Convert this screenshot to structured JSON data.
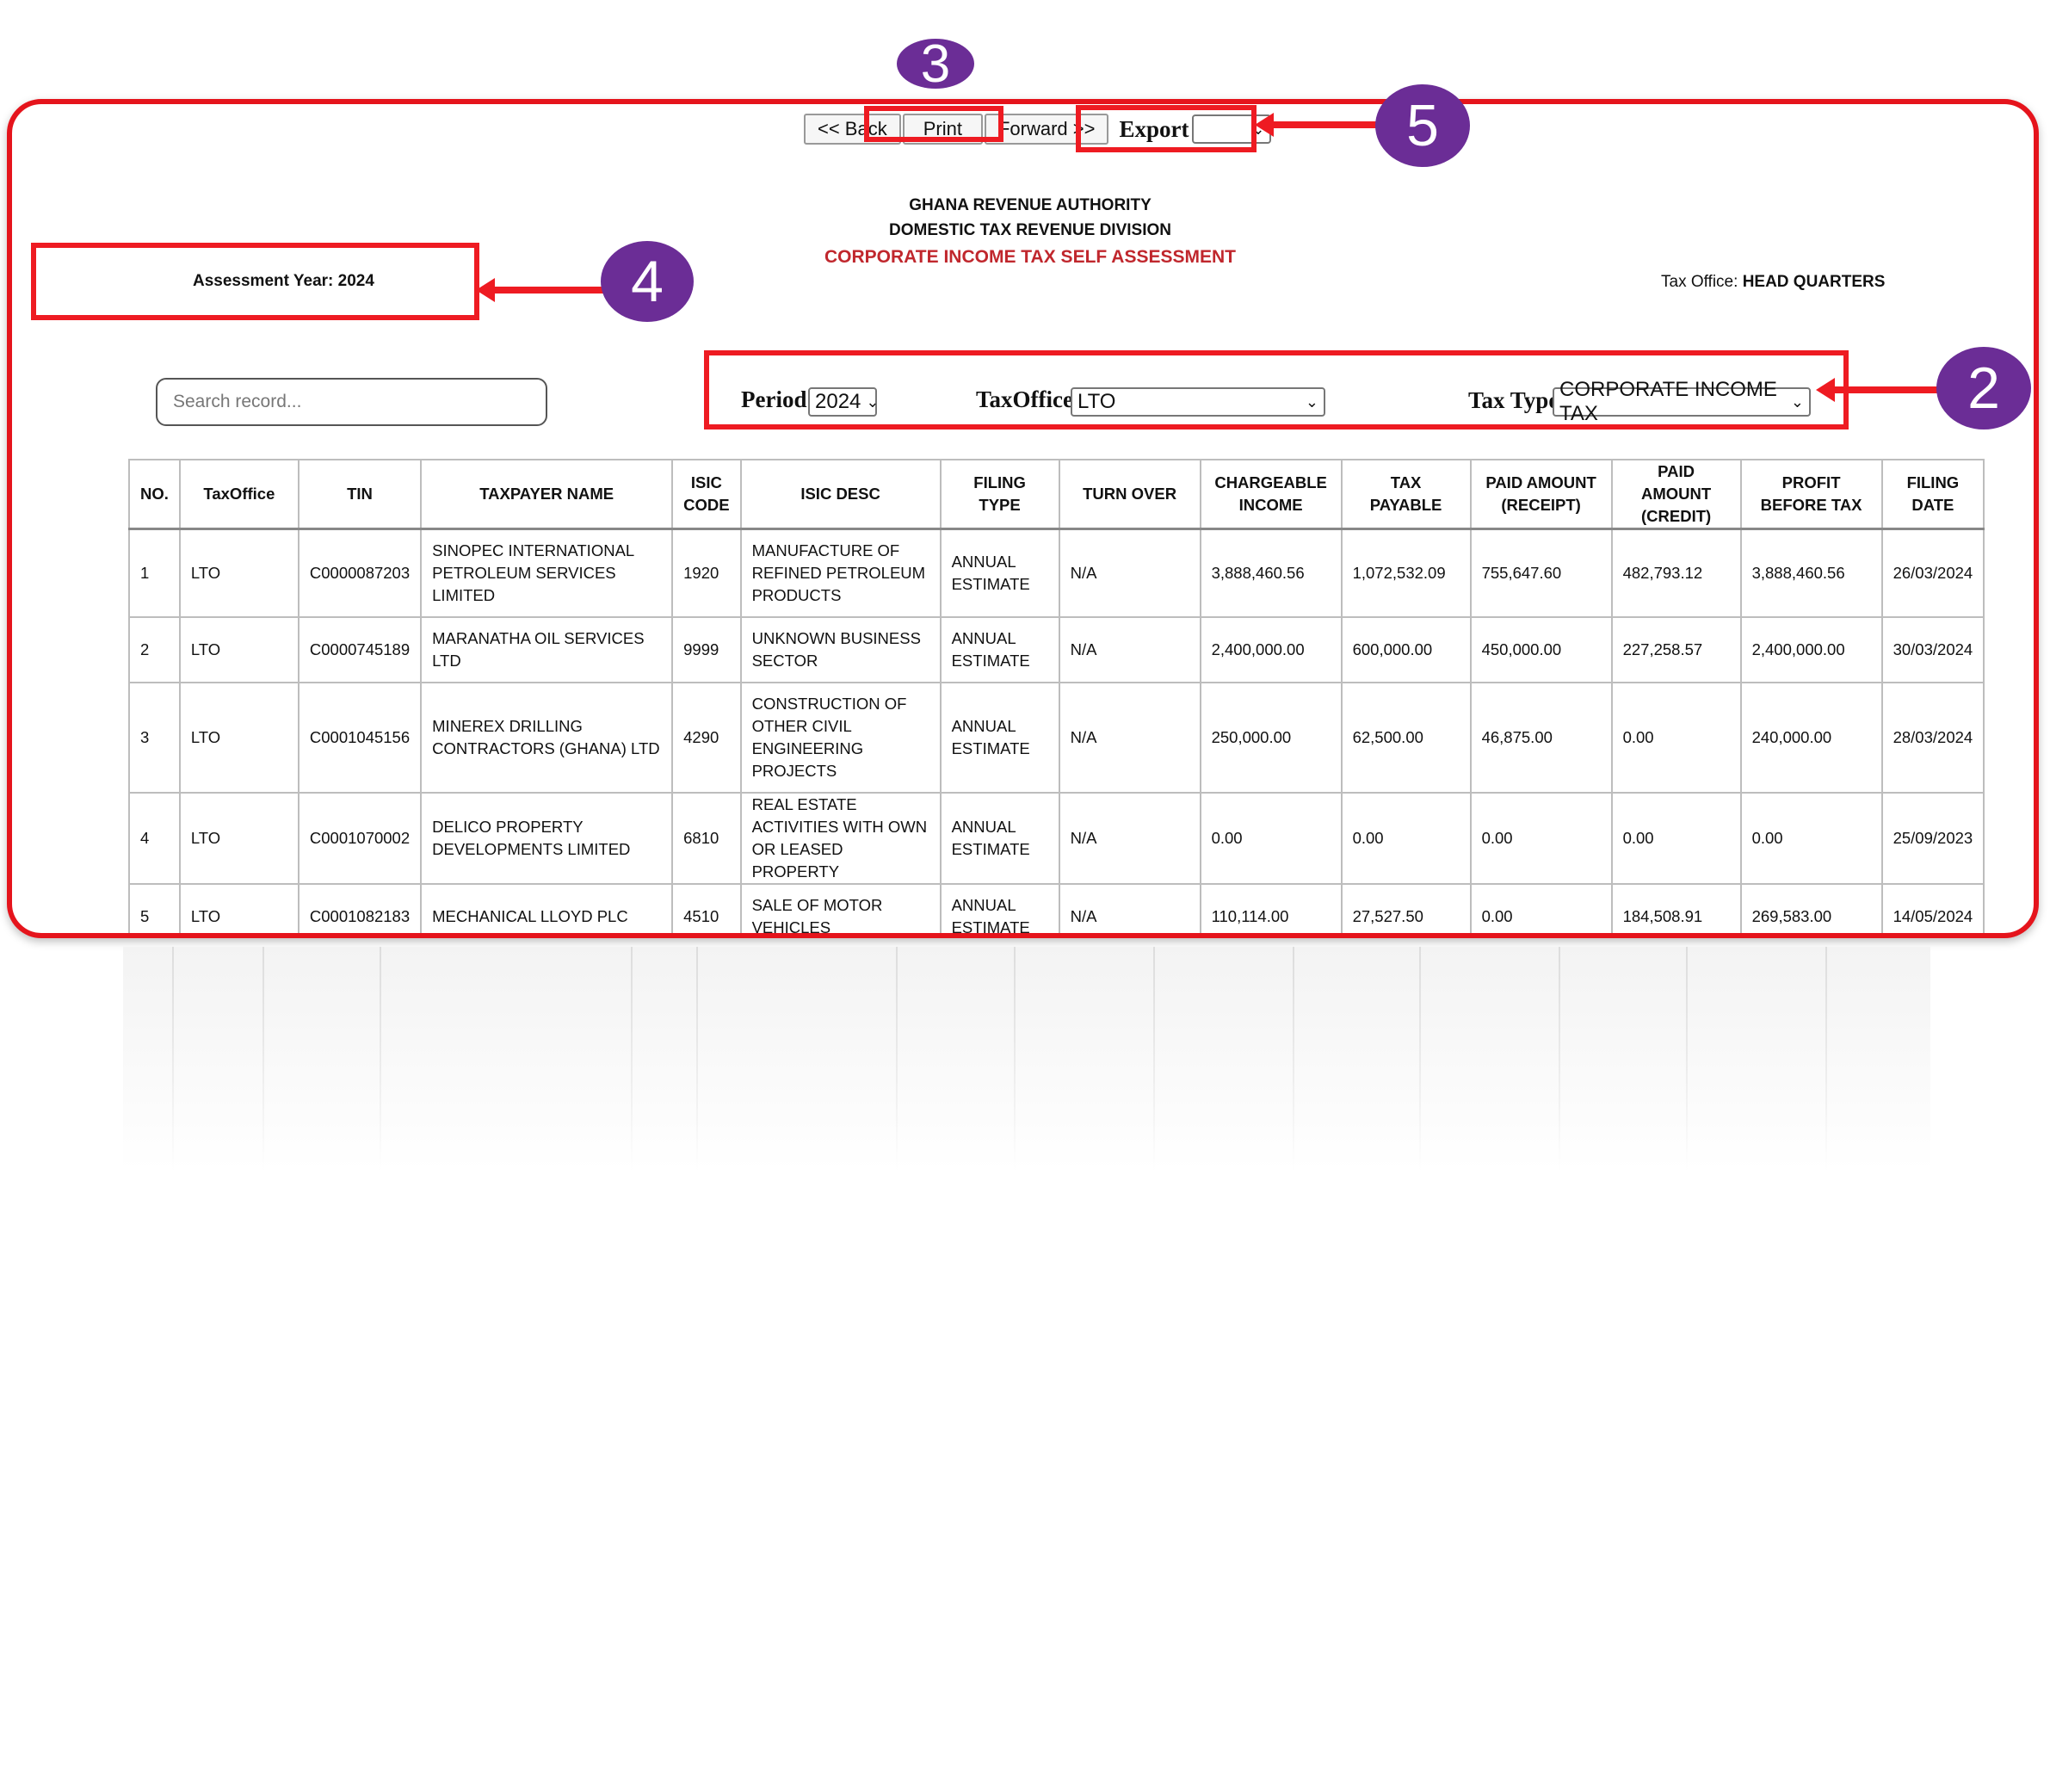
{
  "nav": {
    "back_label": "<< Back",
    "print_label": "Print",
    "forward_label": "Forward >>",
    "export_label": "Export",
    "export_value": ""
  },
  "header": {
    "line1": "GHANA REVENUE AUTHORITY",
    "line2": "DOMESTIC TAX REVENUE DIVISION",
    "line3": "CORPORATE INCOME TAX SELF ASSESSMENT"
  },
  "assessment_year": "Assessment Year: 2024",
  "tax_office": {
    "label": "Tax Office: ",
    "value": "HEAD QUARTERS"
  },
  "search": {
    "placeholder": "Search record..."
  },
  "filters": {
    "period_label": "Period",
    "period_value": "2024",
    "taxoffice_label": "TaxOffice",
    "taxoffice_value": "LTO",
    "taxtype_label": "Tax Type",
    "taxtype_value": "CORPORATE INCOME TAX"
  },
  "table": {
    "headers": [
      "NO.",
      "TaxOffice",
      "TIN",
      "TAXPAYER NAME",
      "ISIC CODE",
      "ISIC DESC",
      "FILING TYPE",
      "TURN OVER",
      "CHARGEABLE INCOME",
      "TAX PAYABLE",
      "PAID AMOUNT (RECEIPT)",
      "PAID AMOUNT (CREDIT)",
      "PROFIT BEFORE TAX",
      "FILING DATE"
    ],
    "rows": [
      [
        "1",
        "LTO",
        "C0000087203",
        "SINOPEC INTERNATIONAL PETROLEUM SERVICES LIMITED",
        "1920",
        "MANUFACTURE OF REFINED PETROLEUM PRODUCTS",
        "ANNUAL ESTIMATE",
        "N/A",
        "3,888,460.56",
        "1,072,532.09",
        "755,647.60",
        "482,793.12",
        "3,888,460.56",
        "26/03/2024"
      ],
      [
        "2",
        "LTO",
        "C0000745189",
        "MARANATHA OIL SERVICES LTD",
        "9999",
        "UNKNOWN BUSINESS SECTOR",
        "ANNUAL ESTIMATE",
        "N/A",
        "2,400,000.00",
        "600,000.00",
        "450,000.00",
        "227,258.57",
        "2,400,000.00",
        "30/03/2024"
      ],
      [
        "3",
        "LTO",
        "C0001045156",
        "MINEREX DRILLING CONTRACTORS (GHANA) LTD",
        "4290",
        "CONSTRUCTION OF OTHER CIVIL ENGINEERING PROJECTS",
        "ANNUAL ESTIMATE",
        "N/A",
        "250,000.00",
        "62,500.00",
        "46,875.00",
        "0.00",
        "240,000.00",
        "28/03/2024"
      ],
      [
        "4",
        "LTO",
        "C0001070002",
        "DELICO PROPERTY DEVELOPMENTS LIMITED",
        "6810",
        "REAL ESTATE ACTIVITIES WITH OWN OR LEASED PROPERTY",
        "ANNUAL ESTIMATE",
        "N/A",
        "0.00",
        "0.00",
        "0.00",
        "0.00",
        "0.00",
        "25/09/2023"
      ],
      [
        "5",
        "LTO",
        "C0001082183",
        "MECHANICAL LLOYD PLC",
        "4510",
        "SALE OF MOTOR VEHICLES",
        "ANNUAL ESTIMATE",
        "N/A",
        "110,114.00",
        "27,527.50",
        "0.00",
        "184,508.91",
        "269,583.00",
        "14/05/2024"
      ]
    ]
  },
  "callouts": {
    "b2": "2",
    "b3": "3",
    "b4": "4",
    "b5": "5"
  },
  "colors": {
    "annotation_red": "#ee1b22",
    "badge_purple": "#6b2d96",
    "title_red": "#c0272d"
  }
}
